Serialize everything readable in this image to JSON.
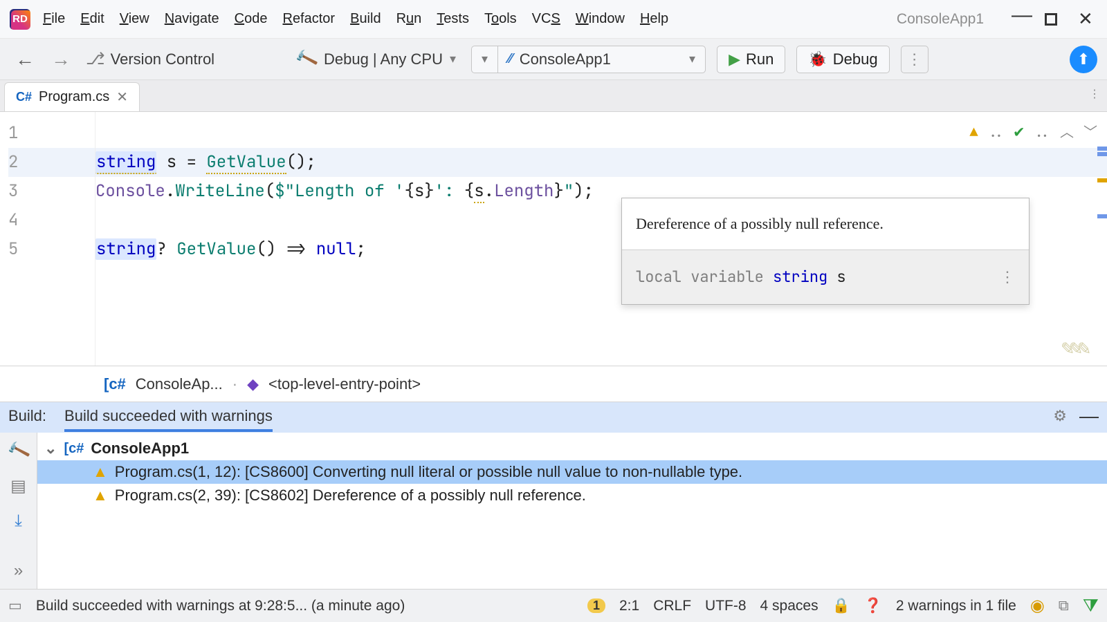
{
  "app": {
    "title": "ConsoleApp1",
    "logo": "RD"
  },
  "menu": [
    "File",
    "Edit",
    "View",
    "Navigate",
    "Code",
    "Refactor",
    "Build",
    "Run",
    "Tests",
    "Tools",
    "VCS",
    "Window",
    "Help"
  ],
  "toolbar": {
    "branch": "Version Control",
    "config": "Debug | Any CPU",
    "target": "ConsoleApp1",
    "run": "Run",
    "debug": "Debug"
  },
  "tab": {
    "lang": "C#",
    "name": "Program.cs"
  },
  "code": {
    "lines": [
      "1",
      "2",
      "3",
      "4",
      "5"
    ],
    "l2": {
      "kw": "string",
      "rest": " s = ",
      "fn": "GetValue",
      "tail": "();"
    },
    "l3": {
      "a": "Console",
      "b": ".",
      "c": "WriteLine",
      "d": "(",
      "e": "$\"Length of '",
      "f": "{s}",
      "g": "': ",
      "h": "{",
      "i": "s",
      "j": ".",
      "k": "Length",
      "l": "}",
      "m": "\"",
      "n": ");"
    },
    "l5": {
      "kw": "string",
      "q": "? ",
      "fn": "GetValue",
      "mid": "() => ",
      "nul": "null",
      "end": ";"
    }
  },
  "hover": {
    "message": "Dereference of a possibly null reference.",
    "sig_prefix": "local variable",
    "sig_type": "string",
    "sig_name": "s"
  },
  "crumbs": {
    "project": "ConsoleAp...",
    "entry": "<top-level-entry-point>"
  },
  "build": {
    "label": "Build:",
    "status": "Build succeeded with warnings",
    "root": "ConsoleApp1",
    "w1": "Program.cs(1, 12): [CS8600] Converting null literal or possible null value to non-nullable type.",
    "w2": "Program.cs(2, 39): [CS8602] Dereference of a possibly null reference."
  },
  "status": {
    "msg": "Build succeeded with warnings at 9:28:5... (a minute ago)",
    "badge": "1",
    "pos": "2:1",
    "eol": "CRLF",
    "enc": "UTF-8",
    "indent": "4 spaces",
    "warnings": "2 warnings in 1 file"
  }
}
